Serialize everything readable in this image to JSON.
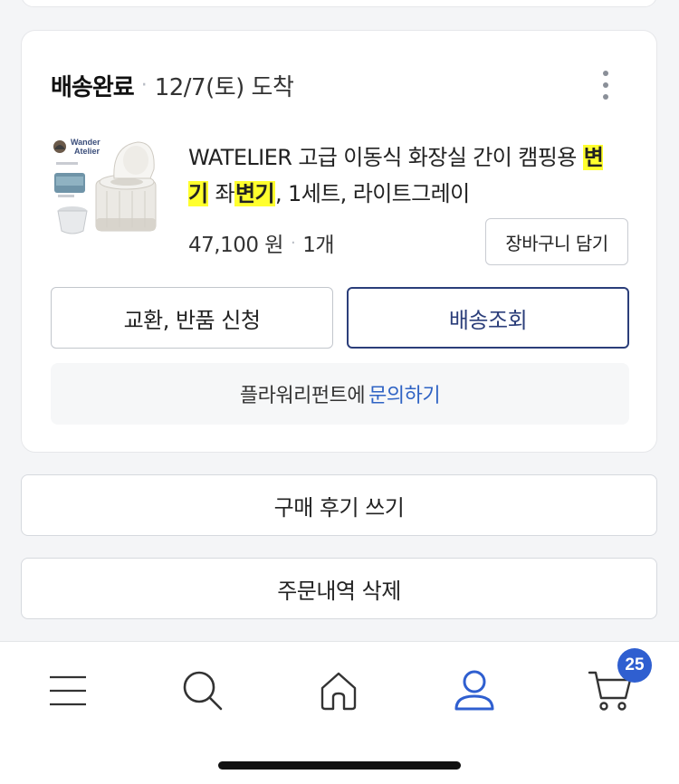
{
  "order": {
    "status": "배송완료",
    "separator": "·",
    "arrival": "12/7(토) 도착",
    "more_icon": "more-vertical-icon"
  },
  "product": {
    "title_part1": "WATELIER 고급 이동식 화장실 간이 캠핑용 ",
    "title_hl1": "변기",
    "title_part2": " 좌",
    "title_hl2": "변기",
    "title_part3": ", 1세트, 라이트그레이",
    "price": "47,100 원",
    "separator": "·",
    "quantity": "1개",
    "cart_button": "장바구니 담기",
    "thumb_brand_line1": "Wander",
    "thumb_brand_line2": "Atelier"
  },
  "actions": {
    "exchange_return": "교환, 반품 신청",
    "track_delivery": "배송조회",
    "inquiry_prefix": "플라워리펀트에",
    "inquiry_link": "문의하기",
    "write_review": "구매 후기 쓰기",
    "delete_order": "주문내역 삭제"
  },
  "tabbar": {
    "items": [
      {
        "icon": "menu-icon"
      },
      {
        "icon": "search-icon"
      },
      {
        "icon": "home-icon"
      },
      {
        "icon": "user-icon",
        "active": true
      },
      {
        "icon": "cart-icon"
      }
    ],
    "cart_badge": "25",
    "active_color": "#2f5fd0"
  },
  "colors": {
    "highlight": "#ffff2e",
    "primary_button_border": "#2b3e7a",
    "link": "#2f63c4"
  }
}
